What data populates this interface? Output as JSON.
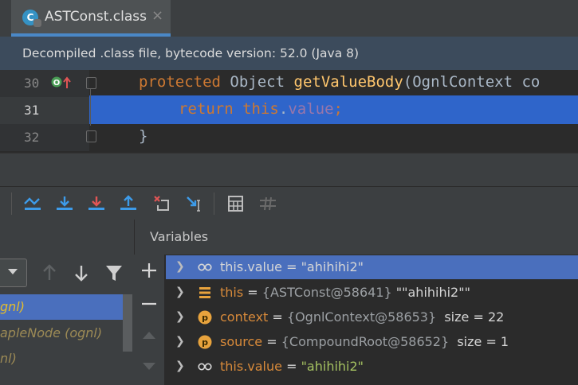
{
  "tab": {
    "label": "ASTConst.class",
    "icon_letter": "C",
    "close": "×"
  },
  "banner": {
    "text": "Decompiled .class file, bytecode version: 52.0 (Java 8)"
  },
  "editor": {
    "lines": [
      {
        "number": "30",
        "tokens": [
          "protected",
          "Object",
          "getValueBody",
          "(OgnlContext co"
        ]
      },
      {
        "number": "31",
        "tokens": [
          "return",
          "this",
          ".",
          "value",
          ";"
        ]
      },
      {
        "number": "32",
        "tokens": [
          "}"
        ]
      }
    ]
  },
  "frames": {
    "items": [
      "gnl)",
      "apleNode (ognl)",
      "nl)"
    ]
  },
  "variables": {
    "title": "Variables",
    "rows": [
      {
        "name": "this.value",
        "eq": " = ",
        "value": "\"ahihihi2\"",
        "icon": "watch-glasses-icon"
      },
      {
        "name": "this",
        "eq": " = ",
        "ref": "{ASTConst@58641}",
        "value": " \"\"ahihihi2\"\"",
        "icon": "fields-icon"
      },
      {
        "name": "context",
        "eq": " = ",
        "ref": "{OgnlContext@58653}",
        "size": "  size = 22",
        "icon": "parameter-p-icon"
      },
      {
        "name": "source",
        "eq": " = ",
        "ref": "{CompoundRoot@58652}",
        "size": "  size = 1",
        "icon": "parameter-p-icon"
      },
      {
        "name": "this.value",
        "eq": " = ",
        "value": "\"ahihihi2\"",
        "icon": "watch-glasses-icon"
      }
    ]
  },
  "colors": {
    "accent": "#4a88c7",
    "selection": "#4a6fbd",
    "keyword": "#cc7832",
    "method": "#ffc66d",
    "field": "#9876aa",
    "string": "#a5c261"
  }
}
